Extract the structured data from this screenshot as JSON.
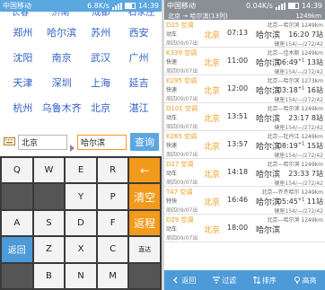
{
  "left_status": {
    "carrier": "中国移动",
    "speed": "6.8K/s",
    "time": "14:39"
  },
  "right_status": {
    "carrier": "中国移动",
    "speed": "0.04K/s",
    "time": "14:39"
  },
  "clipped_row": [
    "长春",
    "济南",
    "成都",
    "石家庄"
  ],
  "cities": [
    "郑州",
    "哈尔滨",
    "苏州",
    "西安",
    "沈阳",
    "南京",
    "武汉",
    "广州",
    "天津",
    "深圳",
    "上海",
    "延吉",
    "杭州",
    "乌鲁木齐",
    "北京",
    "湛江"
  ],
  "search": {
    "from": "北京",
    "to": "哈尔滨",
    "query_label": "查询"
  },
  "keyboard": {
    "row1": [
      "Q",
      "W",
      "E",
      "R"
    ],
    "row2": [
      "Y",
      "P"
    ],
    "row3": [
      "A",
      "S",
      "D",
      "F"
    ],
    "row4": [
      "Z",
      "X",
      "C",
      "B"
    ],
    "row5": [
      "N",
      "M"
    ],
    "backspace": "←",
    "clear": "清空",
    "return_label": "返程",
    "back_label": "返回",
    "direct_label": "直达"
  },
  "route_header": {
    "left": "北京 → 哈尔滨(13列)",
    "right": "1249km"
  },
  "trains": [
    {
      "no": "D25",
      "ac": "空调",
      "kind": "动车",
      "date": "周四09/07出",
      "from": "北京",
      "dep": "07:13",
      "to": "哈尔滨",
      "route": "北京—哈尔滨 1249km",
      "arr": "16:20",
      "arr_day": "",
      "stops": "7站",
      "seat": "硬座154/—/272/42"
    },
    {
      "no": "K339",
      "ac": "空调",
      "kind": "快速",
      "date": "周四09/07出",
      "from": "北京",
      "dep": "11:00",
      "to": "哈尔滨",
      "route": "北京—佳木斯 1249km",
      "arr": "06:49",
      "arr_day": "+1",
      "stops": "13站",
      "seat": "硬座154/—/272/42"
    },
    {
      "no": "K295",
      "ac": "空调",
      "kind": "快速",
      "date": "周四09/07出",
      "from": "北京",
      "dep": "12:00",
      "to": "哈尔滨",
      "route": "北京—哈尔滨 1273km",
      "arr": "03:18",
      "arr_day": "+1",
      "stops": "16站",
      "seat": "硬座154/—/272/42"
    },
    {
      "no": "D101",
      "ac": "空调",
      "kind": "动车",
      "date": "周四09/07出",
      "from": "北京",
      "dep": "13:51",
      "to": "哈尔滨",
      "route": "北京—哈尔滨 1249km",
      "arr": "23:17",
      "arr_day": "",
      "stops": "8站",
      "seat": "硬座154/—/272/42"
    },
    {
      "no": "K265",
      "ac": "空调",
      "kind": "快速",
      "date": "周四09/07出",
      "from": "北京",
      "dep": "13:57",
      "to": "哈尔滨",
      "route": "北京—牡丹江 1249km",
      "arr": "08:19",
      "arr_day": "+1",
      "stops": "15站",
      "seat": "硬座154/—/272/42"
    },
    {
      "no": "D27",
      "ac": "空调",
      "kind": "动车",
      "date": "周四09/07出",
      "from": "北京",
      "dep": "14:18",
      "to": "哈尔滨",
      "route": "北京—哈尔滨 1249km",
      "arr": "23:33",
      "arr_day": "",
      "stops": "7站",
      "seat": "硬座154/—/272/42"
    },
    {
      "no": "T47",
      "ac": "空调",
      "kind": "特快",
      "date": "周四09/07出",
      "from": "北京",
      "dep": "16:46",
      "to": "哈尔滨",
      "route": "北京—齐齐哈尔 1249km",
      "arr": "05:45",
      "arr_day": "+1",
      "stops": "11站",
      "seat": "硬座154/—/272/42"
    },
    {
      "no": "D29",
      "ac": "空调",
      "kind": "动车",
      "date": "周四09/07出",
      "from": "北京",
      "dep": "18:00",
      "to": "哈尔滨",
      "route": "北京—哈尔滨 1249km",
      "arr": "",
      "arr_day": "",
      "stops": "",
      "seat": ""
    }
  ],
  "bottom_bar": {
    "back": "返回",
    "filter": "过滤",
    "sort": "排序",
    "sort_mode": "排序",
    "highlight": "高亮"
  },
  "colors": {
    "accent_blue": "#4d9ad8",
    "accent_orange": "#f29a1c",
    "link_blue": "#2f5fc4"
  }
}
